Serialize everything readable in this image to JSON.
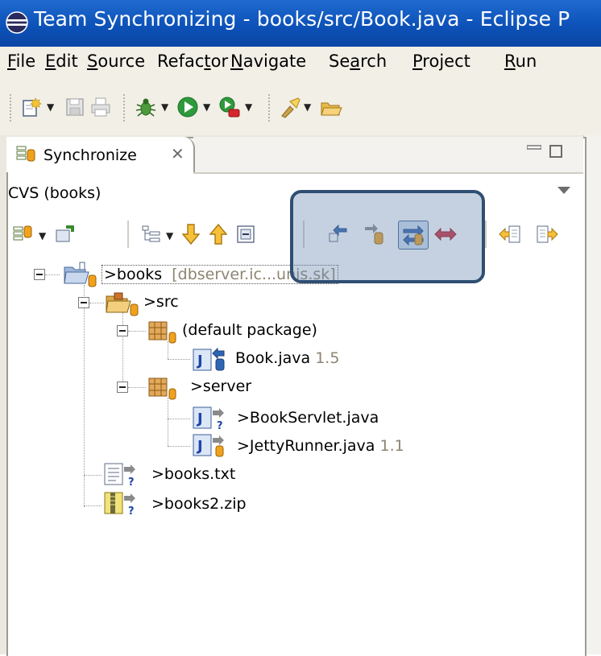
{
  "window": {
    "title": "Team Synchronizing - books/src/Book.java - Eclipse P"
  },
  "menu": [
    {
      "pre": "",
      "acc": "F",
      "post": "ile"
    },
    {
      "pre": "",
      "acc": "E",
      "post": "dit"
    },
    {
      "pre": "",
      "acc": "S",
      "post": "ource"
    },
    {
      "pre": "Refac",
      "acc": "t",
      "post": "or"
    },
    {
      "pre": "",
      "acc": "N",
      "post": "avigate"
    },
    {
      "pre": "Se",
      "acc": "a",
      "post": "rch"
    },
    {
      "pre": "",
      "acc": "P",
      "post": "roject"
    },
    {
      "pre": "",
      "acc": "R",
      "post": "un"
    }
  ],
  "view": {
    "tab_label": "Synchronize",
    "close_glyph": "✕",
    "description": "CVS (books)"
  },
  "tree": [
    {
      "name": "books",
      "prefix": ">",
      "extra": "[dbserver.ic...unis.sk]",
      "icon": "project-folder-icon"
    },
    {
      "name": "src",
      "prefix": ">",
      "extra": "",
      "icon": "source-folder-icon"
    },
    {
      "name": "(default package)",
      "prefix": "",
      "extra": "",
      "icon": "package-icon"
    },
    {
      "name": "Book.java",
      "prefix": "",
      "extra": "1.5",
      "icon": "java-file-incoming-icon"
    },
    {
      "name": "server",
      "prefix": ">",
      "extra": "",
      "icon": "package-icon"
    },
    {
      "name": "BookServlet.java",
      "prefix": ">",
      "extra": "",
      "icon": "java-file-new-icon"
    },
    {
      "name": "JettyRunner.java",
      "prefix": ">",
      "extra": "1.1",
      "icon": "java-file-outgoing-icon"
    },
    {
      "name": "books.txt",
      "prefix": ">",
      "extra": "",
      "icon": "text-file-new-icon"
    },
    {
      "name": "books2.zip",
      "prefix": ">",
      "extra": "",
      "icon": "zip-file-new-icon"
    }
  ],
  "colors": {
    "titlebar": "#0d52b8",
    "highlight_border": "#2f4f72",
    "conflict_red": "#d22b3a",
    "cvs_orange": "#f0a21e"
  }
}
